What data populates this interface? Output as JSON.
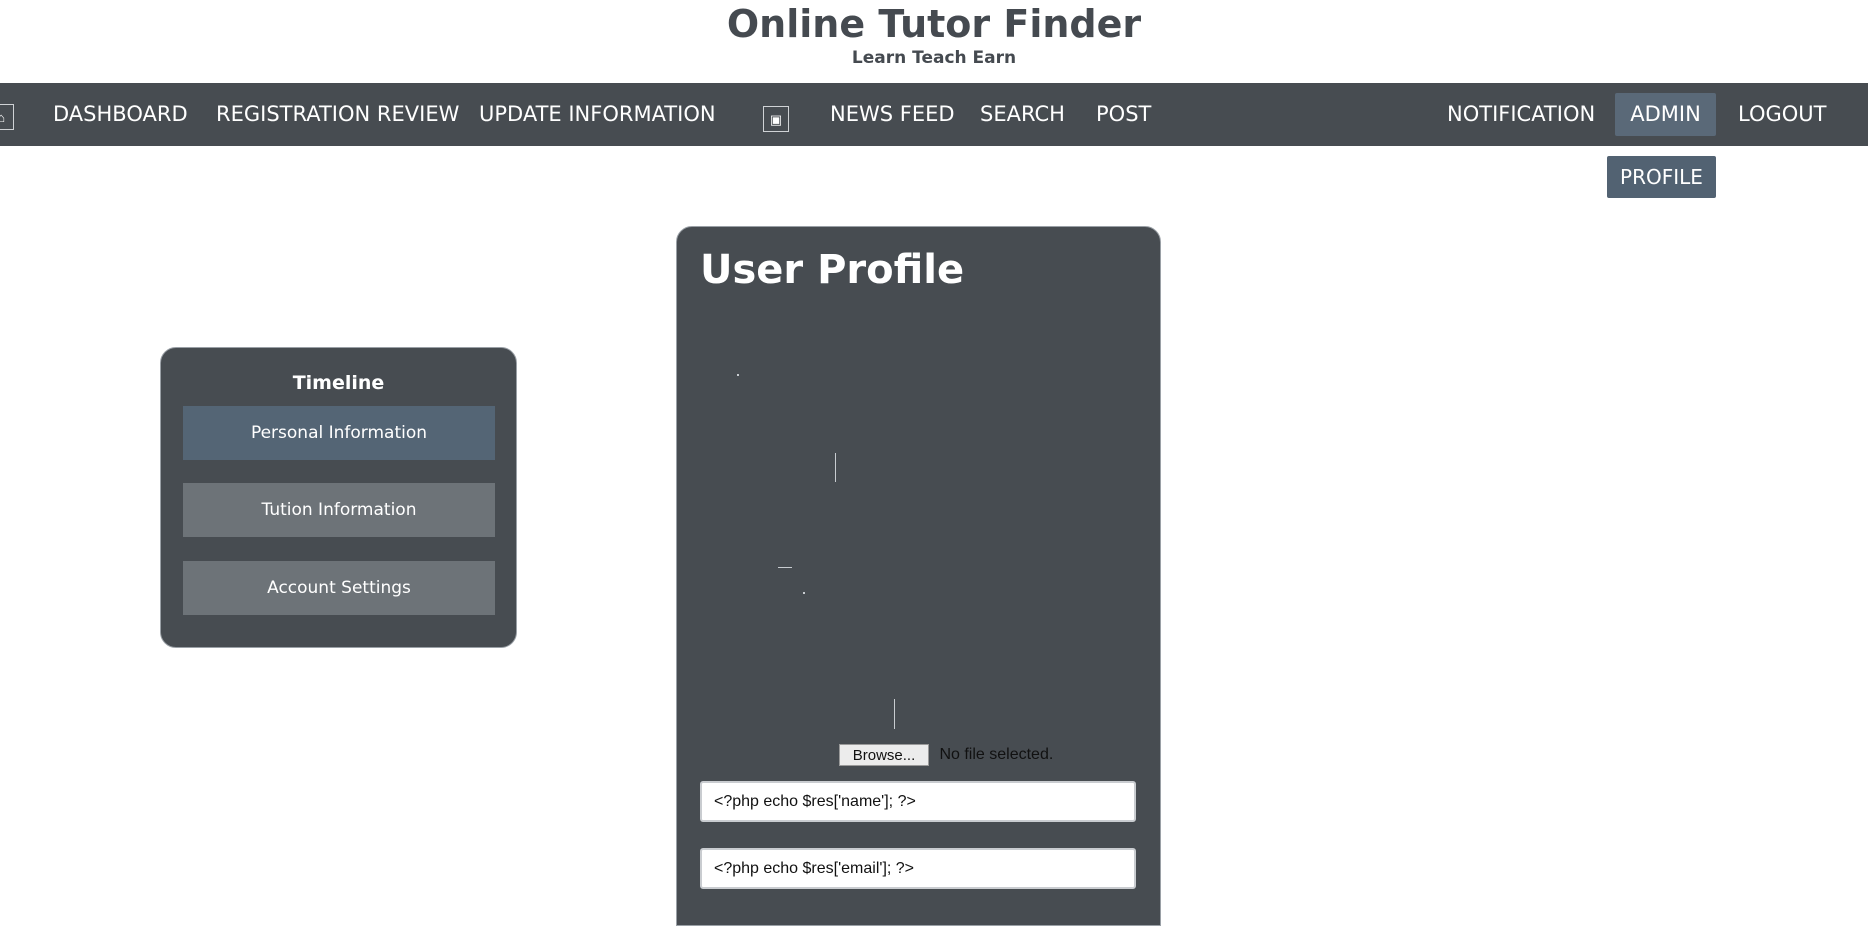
{
  "header": {
    "title": "Online Tutor Finder",
    "tagline": "Learn Teach Earn"
  },
  "nav": {
    "left_icon": "logo-icon",
    "dashboard": "DASHBOARD",
    "registration_review": "REGISTRATION REVIEW",
    "update_information": "UPDATE INFORMATION",
    "mid_icon": "image-icon",
    "news_feed": "NEWS FEED",
    "search": "SEARCH",
    "post": "POST",
    "notification": "NOTIFICATION",
    "admin": "ADMIN",
    "logout": "LOGOUT"
  },
  "dropdown": {
    "profile": "PROFILE"
  },
  "sidebar": {
    "title": "Timeline",
    "items": [
      {
        "label": "Personal Information",
        "active": true
      },
      {
        "label": "Tution Information",
        "active": false
      },
      {
        "label": "Account Settings",
        "active": false
      }
    ]
  },
  "profile_card": {
    "title": "User Profile",
    "browse_label": "Browse...",
    "file_status": "No file selected.",
    "name_value": "<?php echo $res['name']; ?>",
    "email_value": "<?php echo $res['email']; ?>"
  },
  "colors": {
    "navbar": "#474c51",
    "active_nav": "#5a6978",
    "active_sidebar": "#546575",
    "inactive_sidebar": "#6d7378",
    "title_text": "#454a50"
  }
}
